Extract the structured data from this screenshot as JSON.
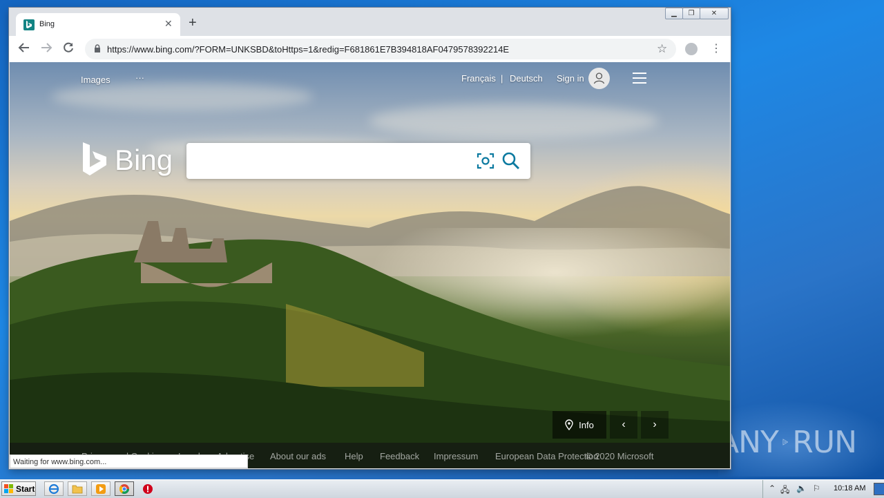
{
  "browser": {
    "tab": {
      "title": "Bing"
    },
    "url": "https://www.bing.com/?FORM=UNKSBD&toHttps=1&redig=F681861E7B394818AF0479578392214E",
    "status_text": "Waiting for www.bing.com..."
  },
  "bing": {
    "nav": {
      "images": "Images",
      "more": "···"
    },
    "header": {
      "lang1": "Français",
      "separator": "|",
      "lang2": "Deutsch",
      "signin": "Sign in"
    },
    "logo_text": "Bing",
    "search": {
      "value": "",
      "placeholder": ""
    },
    "info_label": "Info",
    "footer": {
      "links": [
        "Privacy and Cookies",
        "Legal",
        "Advertise",
        "About our ads",
        "Help",
        "Feedback",
        "Impressum",
        "European Data Protection"
      ],
      "copyright": "© 2020 Microsoft"
    }
  },
  "taskbar": {
    "start_label": "Start",
    "clock": "10:18 AM"
  },
  "watermark": {
    "left": "ANY",
    "right": "RUN"
  },
  "colors": {
    "bing_teal": "#138484",
    "desktop_blue": "#1e88e5"
  }
}
